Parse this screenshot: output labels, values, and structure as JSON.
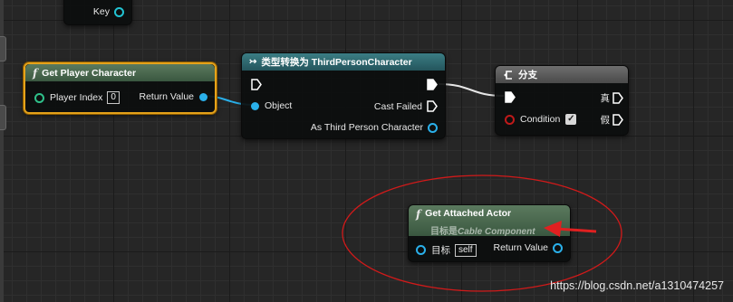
{
  "nodes": {
    "top_partial": {
      "pin_label": "Key"
    },
    "get_player_character": {
      "title": "Get Player Character",
      "input_label": "Player Index",
      "input_value": "0",
      "output_label": "Return Value"
    },
    "cast": {
      "title": "类型转换为 ThirdPersonCharacter",
      "object_label": "Object",
      "cast_failed_label": "Cast Failed",
      "as_label": "As Third Person Character"
    },
    "branch": {
      "title": "分支",
      "true_label": "真",
      "false_label": "假",
      "condition_label": "Condition",
      "condition_checked": "✓"
    },
    "get_attached_actor": {
      "title": "Get Attached Actor",
      "subtitle_prefix": "目标是",
      "subtitle_target": "Cable Component",
      "target_label": "目标",
      "target_value": "self",
      "output_label": "Return Value"
    }
  },
  "colors": {
    "annotation_red": "#d11a1a",
    "selection_orange": "#e5a21a",
    "object_pin": "#2ab0ea"
  },
  "watermark": "https://blog.csdn.net/a1310474257"
}
